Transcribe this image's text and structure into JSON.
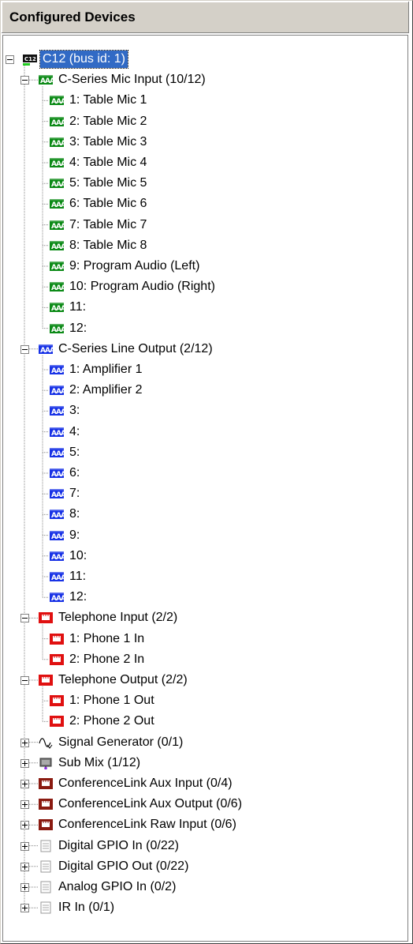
{
  "panel": {
    "title": "Configured Devices"
  },
  "colors": {
    "selection": "#316ac5",
    "mic": "#0b8a16",
    "line": "#1832e6",
    "phone": "#e01010",
    "conflink": "#8a1a10"
  },
  "tree": [
    {
      "level": 0,
      "label": "C12 (bus id: 1)",
      "icon": "device-c12-icon",
      "toggle": "open",
      "selected": true,
      "name": "tree-item-c12"
    },
    {
      "level": 1,
      "label": "C-Series Mic Input (10/12)",
      "icon": "mic-channel-icon",
      "toggle": "open",
      "name": "tree-item-mic-input"
    },
    {
      "level": 2,
      "label": "1: Table Mic 1",
      "icon": "mic-channel-icon",
      "name": "tree-item-mic-1"
    },
    {
      "level": 2,
      "label": "2: Table Mic 2",
      "icon": "mic-channel-icon",
      "name": "tree-item-mic-2"
    },
    {
      "level": 2,
      "label": "3: Table Mic 3",
      "icon": "mic-channel-icon",
      "name": "tree-item-mic-3"
    },
    {
      "level": 2,
      "label": "4: Table Mic 4",
      "icon": "mic-channel-icon",
      "name": "tree-item-mic-4"
    },
    {
      "level": 2,
      "label": "5: Table Mic 5",
      "icon": "mic-channel-icon",
      "name": "tree-item-mic-5"
    },
    {
      "level": 2,
      "label": "6: Table Mic 6",
      "icon": "mic-channel-icon",
      "name": "tree-item-mic-6"
    },
    {
      "level": 2,
      "label": "7: Table Mic 7",
      "icon": "mic-channel-icon",
      "name": "tree-item-mic-7"
    },
    {
      "level": 2,
      "label": "8: Table Mic 8",
      "icon": "mic-channel-icon",
      "name": "tree-item-mic-8"
    },
    {
      "level": 2,
      "label": "9: Program Audio (Left)",
      "icon": "mic-channel-icon",
      "name": "tree-item-mic-9"
    },
    {
      "level": 2,
      "label": "10: Program Audio (Right)",
      "icon": "mic-channel-icon",
      "name": "tree-item-mic-10"
    },
    {
      "level": 2,
      "label": "11:",
      "icon": "mic-channel-icon",
      "name": "tree-item-mic-11"
    },
    {
      "level": 2,
      "label": "12:",
      "icon": "mic-channel-icon",
      "name": "tree-item-mic-12"
    },
    {
      "level": 1,
      "label": "C-Series Line Output (2/12)",
      "icon": "line-output-icon",
      "toggle": "open",
      "name": "tree-item-line-output"
    },
    {
      "level": 2,
      "label": "1: Amplifier 1",
      "icon": "line-output-icon",
      "name": "tree-item-line-1"
    },
    {
      "level": 2,
      "label": "2: Amplifier 2",
      "icon": "line-output-icon",
      "name": "tree-item-line-2"
    },
    {
      "level": 2,
      "label": "3:",
      "icon": "line-output-icon",
      "name": "tree-item-line-3"
    },
    {
      "level": 2,
      "label": "4:",
      "icon": "line-output-icon",
      "name": "tree-item-line-4"
    },
    {
      "level": 2,
      "label": "5:",
      "icon": "line-output-icon",
      "name": "tree-item-line-5"
    },
    {
      "level": 2,
      "label": "6:",
      "icon": "line-output-icon",
      "name": "tree-item-line-6"
    },
    {
      "level": 2,
      "label": "7:",
      "icon": "line-output-icon",
      "name": "tree-item-line-7"
    },
    {
      "level": 2,
      "label": "8:",
      "icon": "line-output-icon",
      "name": "tree-item-line-8"
    },
    {
      "level": 2,
      "label": "9:",
      "icon": "line-output-icon",
      "name": "tree-item-line-9"
    },
    {
      "level": 2,
      "label": "10:",
      "icon": "line-output-icon",
      "name": "tree-item-line-10"
    },
    {
      "level": 2,
      "label": "11:",
      "icon": "line-output-icon",
      "name": "tree-item-line-11"
    },
    {
      "level": 2,
      "label": "12:",
      "icon": "line-output-icon",
      "name": "tree-item-line-12"
    },
    {
      "level": 1,
      "label": "Telephone Input (2/2)",
      "icon": "telephone-icon",
      "toggle": "open",
      "name": "tree-item-telephone-input"
    },
    {
      "level": 2,
      "label": "1: Phone 1 In",
      "icon": "telephone-icon",
      "name": "tree-item-phone-in-1"
    },
    {
      "level": 2,
      "label": "2: Phone 2 In",
      "icon": "telephone-icon",
      "name": "tree-item-phone-in-2"
    },
    {
      "level": 1,
      "label": "Telephone Output (2/2)",
      "icon": "telephone-icon",
      "toggle": "open",
      "name": "tree-item-telephone-output"
    },
    {
      "level": 2,
      "label": "1: Phone 1 Out",
      "icon": "telephone-icon",
      "name": "tree-item-phone-out-1"
    },
    {
      "level": 2,
      "label": "2: Phone 2 Out",
      "icon": "telephone-icon",
      "name": "tree-item-phone-out-2"
    },
    {
      "level": 1,
      "label": "Signal Generator (0/1)",
      "icon": "signal-generator-icon",
      "toggle": "closed",
      "name": "tree-item-signal-generator"
    },
    {
      "level": 1,
      "label": "Sub Mix (1/12)",
      "icon": "sub-mix-icon",
      "toggle": "closed",
      "name": "tree-item-sub-mix"
    },
    {
      "level": 1,
      "label": "ConferenceLink Aux Input (0/4)",
      "icon": "conferencelink-icon",
      "toggle": "closed",
      "name": "tree-item-conflink-aux-input"
    },
    {
      "level": 1,
      "label": "ConferenceLink Aux Output (0/6)",
      "icon": "conferencelink-icon",
      "toggle": "closed",
      "name": "tree-item-conflink-aux-output"
    },
    {
      "level": 1,
      "label": "ConferenceLink Raw Input (0/6)",
      "icon": "conferencelink-icon",
      "toggle": "closed",
      "name": "tree-item-conflink-raw-input"
    },
    {
      "level": 1,
      "label": "Digital GPIO In (0/22)",
      "icon": "gpio-icon",
      "toggle": "closed",
      "name": "tree-item-digital-gpio-in"
    },
    {
      "level": 1,
      "label": "Digital GPIO Out (0/22)",
      "icon": "gpio-icon",
      "toggle": "closed",
      "name": "tree-item-digital-gpio-out"
    },
    {
      "level": 1,
      "label": "Analog GPIO In (0/2)",
      "icon": "gpio-icon",
      "toggle": "closed",
      "name": "tree-item-analog-gpio-in"
    },
    {
      "level": 1,
      "label": "IR In (0/1)",
      "icon": "gpio-icon",
      "toggle": "closed",
      "name": "tree-item-ir-in"
    }
  ]
}
